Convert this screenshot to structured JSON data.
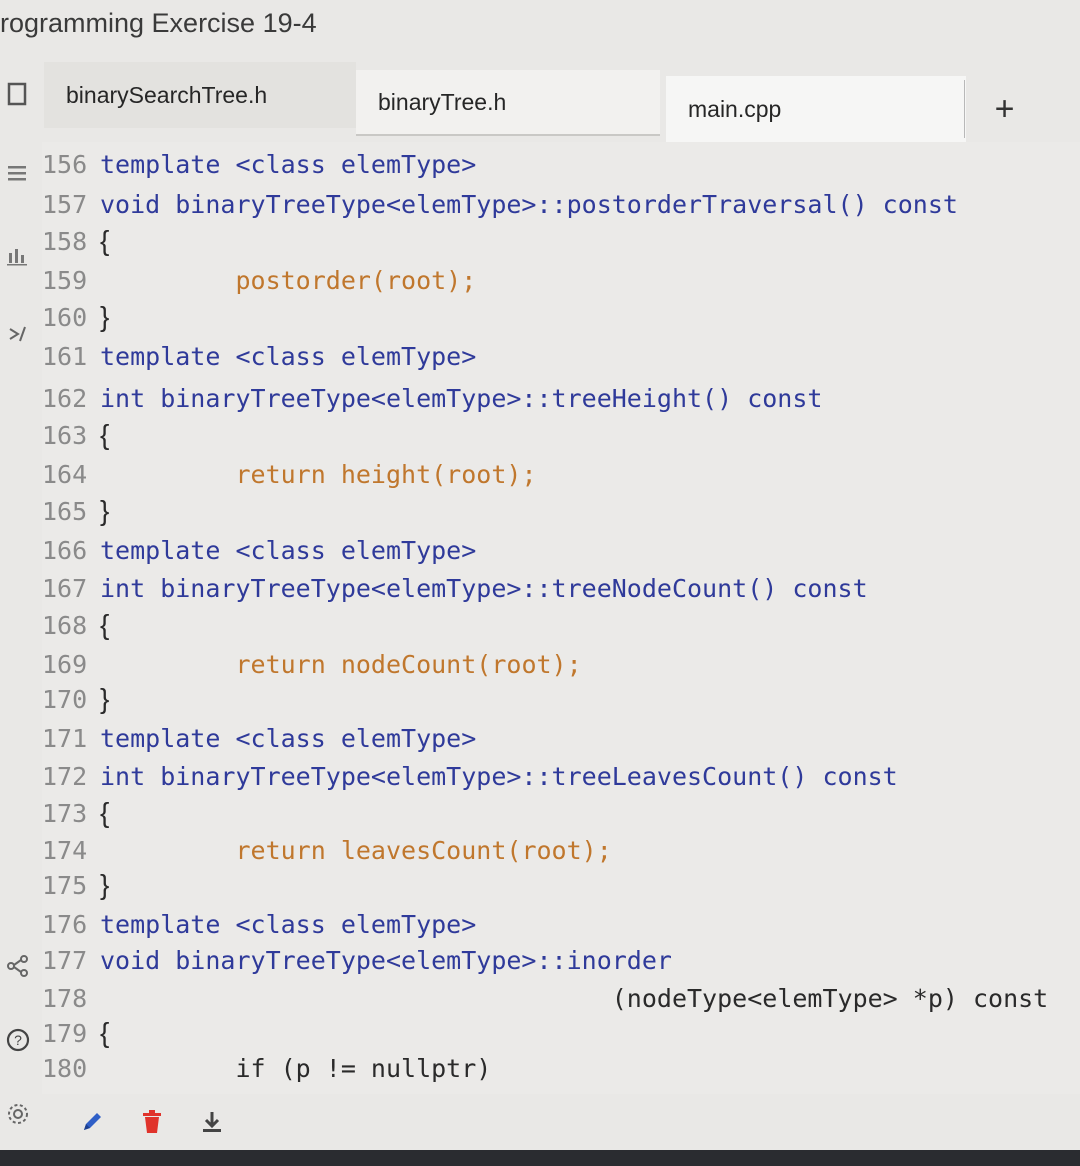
{
  "window": {
    "title": "rogramming Exercise 19-4"
  },
  "tabs": [
    {
      "label": "binarySearchTree.h"
    },
    {
      "label": "binaryTree.h"
    },
    {
      "label": "main.cpp"
    }
  ],
  "add_tab_label": "+",
  "code": {
    "lines": [
      {
        "num": "156",
        "text": "template <class elemType>"
      },
      {
        "num": "157",
        "text": "void binaryTreeType<elemType>::postorderTraversal() const"
      },
      {
        "num": "158",
        "text": "{"
      },
      {
        "num": "159",
        "text": "postorder(root);"
      },
      {
        "num": "160",
        "text": "}"
      },
      {
        "num": "161",
        "text": "template <class elemType>"
      },
      {
        "num": "162",
        "text": "int binaryTreeType<elemType>::treeHeight() const"
      },
      {
        "num": "163",
        "text": "{"
      },
      {
        "num": "164",
        "text": "return height(root);"
      },
      {
        "num": "165",
        "text": "}"
      },
      {
        "num": "166",
        "text": "template <class elemType>"
      },
      {
        "num": "167",
        "text": "int binaryTreeType<elemType>::treeNodeCount() const"
      },
      {
        "num": "168",
        "text": "{"
      },
      {
        "num": "169",
        "text": "return nodeCount(root);"
      },
      {
        "num": "170",
        "text": "}"
      },
      {
        "num": "171",
        "text": "template <class elemType>"
      },
      {
        "num": "172",
        "text": "int binaryTreeType<elemType>::treeLeavesCount() const"
      },
      {
        "num": "173",
        "text": "{"
      },
      {
        "num": "174",
        "text": "return leavesCount(root);"
      },
      {
        "num": "175",
        "text": "}"
      },
      {
        "num": "176",
        "text": "template <class elemType>"
      },
      {
        "num": "177",
        "text": "void binaryTreeType<elemType>::inorder"
      },
      {
        "num": "178",
        "text": "(nodeType<elemType> *p) const"
      },
      {
        "num": "179",
        "text": "{"
      },
      {
        "num": "180",
        "text": "if (p != nullptr)"
      }
    ]
  },
  "sidebar": {
    "icons": [
      "file-icon",
      "menu-icon",
      "chart-icon",
      "code-icon",
      "share-icon",
      "help-icon",
      "settings-icon"
    ]
  },
  "toolbar": {
    "icons": [
      "pencil-icon",
      "trash-icon",
      "download-icon"
    ]
  },
  "colors": {
    "keyword": "#2f3a9a",
    "function": "#c0772d",
    "pencil": "#2f5fc7",
    "trash": "#e0332b"
  }
}
